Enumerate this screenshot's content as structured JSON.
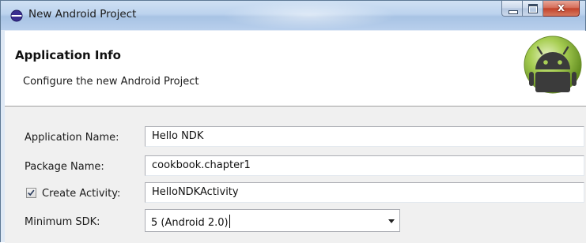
{
  "window": {
    "title": "New Android Project",
    "controls": {
      "minimize": "",
      "maximize": "",
      "close": "x"
    }
  },
  "header": {
    "title": "Application Info",
    "description": "Configure the new Android Project",
    "logo_icon": "android-logo-icon"
  },
  "form": {
    "application_name": {
      "label": "Application Name:",
      "value": "Hello NDK"
    },
    "package_name": {
      "label": "Package Name:",
      "value": "cookbook.chapter1"
    },
    "create_activity": {
      "label": "Create Activity:",
      "checked": true,
      "value": "HelloNDKActivity"
    },
    "minimum_sdk": {
      "label": "Minimum SDK:",
      "value": "5 (Android 2.0)"
    }
  },
  "colors": {
    "close_button": "#c2432b",
    "android_green": "#9cc63b"
  }
}
